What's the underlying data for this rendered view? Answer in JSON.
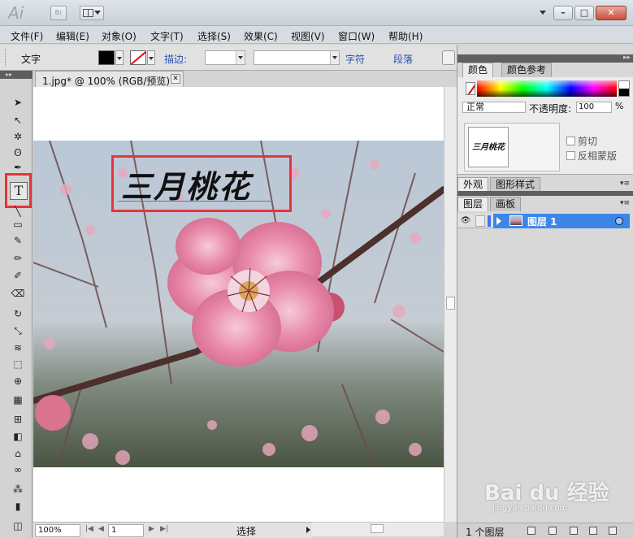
{
  "app": {
    "logo": "Ai",
    "bridge": "Br",
    "window_buttons": {
      "minimize": "–",
      "maximize": "□",
      "close": "✕"
    }
  },
  "menubar": [
    "文件(F)",
    "编辑(E)",
    "对象(O)",
    "文字(T)",
    "选择(S)",
    "效果(C)",
    "视图(V)",
    "窗口(W)",
    "帮助(H)"
  ],
  "controlbar": {
    "tool_name": "文字",
    "stroke_label": "描边:",
    "character_link": "字符",
    "paragraph_link": "段落"
  },
  "document": {
    "tab_title": "1.jpg* @ 100% (RGB/预览)",
    "headline_text": "三月桃花",
    "zoom": "100%",
    "page": "1",
    "status": "选择"
  },
  "panels": {
    "color_tabs": [
      "颜色",
      "颜色参考"
    ],
    "transparency": {
      "blend_mode": "正常",
      "opacity_label": "不透明度:",
      "opacity_value": "100",
      "opacity_unit": "%",
      "clip_label": "剪切",
      "invert_mask_label": "反相蒙版",
      "thumb_text": "三月桃花"
    },
    "appearance_tabs": [
      "外观",
      "图形样式"
    ],
    "layers_tabs": [
      "图层",
      "画板"
    ],
    "layer": {
      "name": "图层 1"
    },
    "layer_count": "1 个图层"
  },
  "watermark": {
    "brand": "Bai du 经验",
    "url": "jingyan.baidu.com"
  },
  "colors": {
    "highlight_red": "#e8333a",
    "layer_selected": "#3d86e8",
    "titlebar": "#d2d8de"
  }
}
